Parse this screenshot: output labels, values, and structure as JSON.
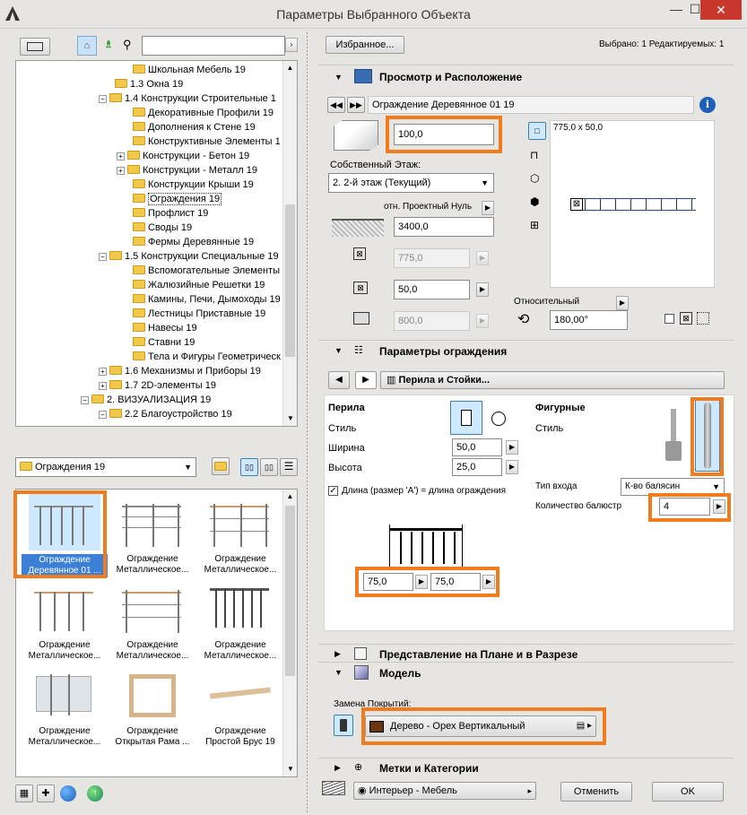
{
  "window": {
    "title": "Параметры Выбранного Объекта",
    "minimize": "—",
    "maximize": "☐",
    "close": "✕"
  },
  "tree": {
    "items": [
      {
        "label": "Школьная Мебель 19"
      },
      {
        "label": "1.3 Окна 19"
      },
      {
        "label": "1.4 Конструкции Строительные 1"
      },
      {
        "label": "Декоративные Профили 19"
      },
      {
        "label": "Дополнения к Стене 19"
      },
      {
        "label": "Конструктивные Элементы 1"
      },
      {
        "label": "Конструкции - Бетон 19"
      },
      {
        "label": "Конструкции - Металл 19"
      },
      {
        "label": "Конструкции Крыши 19"
      },
      {
        "label": "Ограждения 19"
      },
      {
        "label": "Профлист 19"
      },
      {
        "label": "Своды 19"
      },
      {
        "label": "Фермы Деревянные 19"
      },
      {
        "label": "1.5 Конструкции Специальные 19"
      },
      {
        "label": "Вспомогательные Элементы"
      },
      {
        "label": "Жалюзийные Решетки 19"
      },
      {
        "label": "Камины, Печи, Дымоходы 19"
      },
      {
        "label": "Лестницы Приставные 19"
      },
      {
        "label": "Навесы 19"
      },
      {
        "label": "Ставни 19"
      },
      {
        "label": "Тела и Фигуры Геометрическ"
      },
      {
        "label": "1.6 Механизмы и Приборы 19"
      },
      {
        "label": "1.7 2D-элементы 19"
      },
      {
        "label": "2. ВИЗУАЛИЗАЦИЯ 19"
      },
      {
        "label": "2.2 Благоустройство 19"
      }
    ]
  },
  "folder_select": {
    "value": "Ограждения 19"
  },
  "thumbs": [
    {
      "l1": "Ограждение",
      "l2": "Деревянное 01 ..."
    },
    {
      "l1": "Ограждение",
      "l2": "Металлическое..."
    },
    {
      "l1": "Ограждение",
      "l2": "Металлическое..."
    },
    {
      "l1": "Ограждение",
      "l2": "Металлическое..."
    },
    {
      "l1": "Ограждение",
      "l2": "Металлическое..."
    },
    {
      "l1": "Ограждение",
      "l2": "Металлическое..."
    },
    {
      "l1": "Ограждение",
      "l2": "Металлическое..."
    },
    {
      "l1": "Ограждение",
      "l2": "Открытая Рама ..."
    },
    {
      "l1": "Ограждение",
      "l2": "Простой Брус 19"
    }
  ],
  "header": {
    "favorites": "Избранное...",
    "selected": "Выбрано: 1 Редактируемых: 1"
  },
  "preview": {
    "section": "Просмотр и Расположение",
    "object_name": "Ограждение Деревянное 01 19",
    "height_value": "100,0",
    "story_label": "Собственный Этаж:",
    "story_value": "2. 2-й этаж (Текущий)",
    "ref_label": "отн. Проектный Нуль",
    "elevation": "3400,0",
    "a_value": "775,0",
    "b_value": "50,0",
    "c_value": "800,0",
    "preview_dims": "775,0 x 50,0",
    "rel_label": "Относительный",
    "angle": "180,00°"
  },
  "railing": {
    "section": "Параметры ограждения",
    "tab": "Перила и Стойки...",
    "perila": "Перила",
    "style": "Стиль",
    "width_label": "Ширина",
    "width": "50,0",
    "height_label": "Высота",
    "height": "25,0",
    "check_label": "Длина (размер 'A') = длина ограждения",
    "figured": "Фигурные",
    "style2": "Стиль",
    "entry_label": "Тип входа",
    "entry_value": "К-во балясин",
    "count_label": "Количество балюстр",
    "count": "4",
    "dim1": "75,0",
    "dim2": "75,0"
  },
  "sections": {
    "plan": "Представление на Плане и в Разрезе",
    "model": "Модель",
    "tags": "Метки и Категории"
  },
  "model": {
    "override_label": "Замена Покрытий:",
    "material": "Дерево - Орех Вертикальный"
  },
  "footer": {
    "layer": "Интерьер - Мебель",
    "cancel": "Отменить",
    "ok": "OK"
  },
  "colors": {
    "accent": "#f07c1e",
    "selection": "#cde8ff",
    "close": "#c7372c"
  }
}
